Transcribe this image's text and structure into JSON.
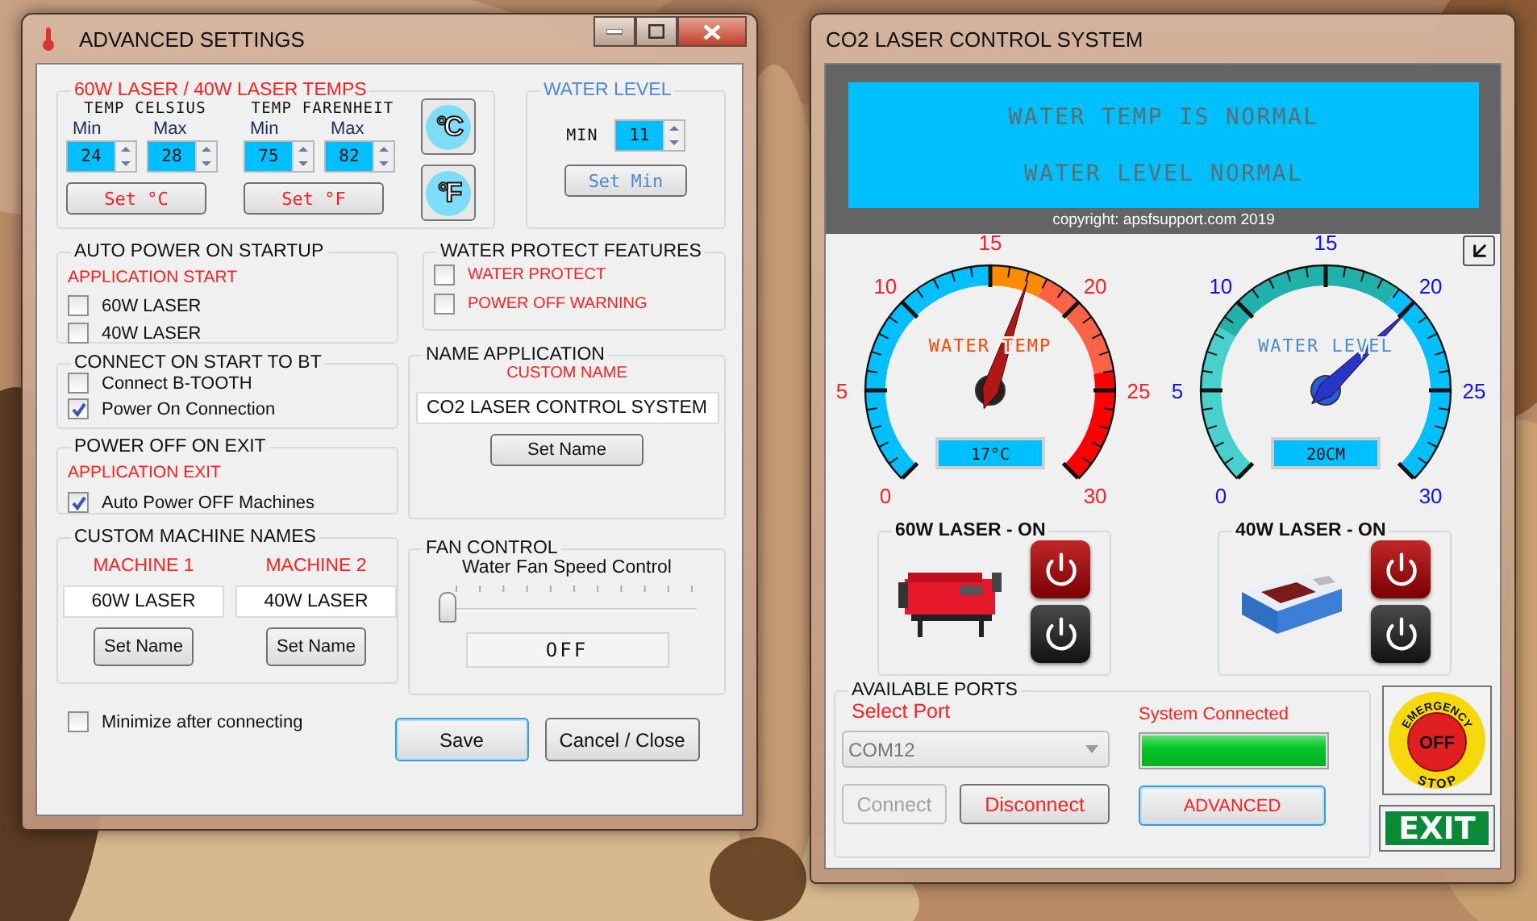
{
  "advanced_window": {
    "title": "ADVANCED SETTINGS",
    "temps": {
      "title": "60W LASER / 40W LASER TEMPS",
      "units": [
        {
          "heading": "TEMP CELSIUS",
          "fields": [
            {
              "label": "Min",
              "value": "24"
            },
            {
              "label": "Max",
              "value": "28"
            }
          ],
          "button": "Set °C"
        },
        {
          "heading": "TEMP FARENHEIT",
          "fields": [
            {
              "label": "Min",
              "value": "75"
            },
            {
              "label": "Max",
              "value": "82"
            }
          ],
          "button": "Set °F"
        }
      ],
      "unit_buttons": [
        "°C",
        "°F"
      ]
    },
    "water_level": {
      "title": "WATER LEVEL",
      "label": "MIN",
      "value": "11",
      "button": "Set Min"
    },
    "auto_power": {
      "title": "AUTO POWER ON STARTUP",
      "subtitle": "APPLICATION  START",
      "options": [
        {
          "label": "60W  LASER",
          "checked": false
        },
        {
          "label": "40W  LASER",
          "checked": false
        }
      ]
    },
    "water_protect": {
      "title": "WATER PROTECT FEATURES",
      "options": [
        {
          "label": "WATER PROTECT",
          "checked": false
        },
        {
          "label": "POWER OFF WARNING",
          "checked": false
        }
      ]
    },
    "connect_bt": {
      "title": "CONNECT ON START TO BT",
      "options": [
        {
          "label": "Connect B-TOOTH",
          "checked": false
        },
        {
          "label": "Power On Connection",
          "checked": true
        }
      ]
    },
    "name_application": {
      "title": "NAME APPLICATION",
      "subtitle": "CUSTOM NAME",
      "value": "CO2 LASER CONTROL SYSTEM",
      "button": "Set Name"
    },
    "power_off": {
      "title": "POWER OFF ON EXIT",
      "subtitle": "APPLICATION EXIT",
      "options": [
        {
          "label": "Auto Power OFF Machines",
          "checked": true
        }
      ]
    },
    "machine_names": {
      "title": "CUSTOM MACHINE NAMES",
      "machines": [
        {
          "label": "MACHINE 1",
          "value": "60W LASER",
          "button": "Set Name"
        },
        {
          "label": "MACHINE 2",
          "value": "40W LASER",
          "button": "Set Name"
        }
      ]
    },
    "fan": {
      "title": "FAN CONTROL",
      "label": "Water Fan Speed Control",
      "level": 0,
      "reading": "OFF"
    },
    "minimize": {
      "label": "Minimize after connecting",
      "checked": false
    },
    "buttons": [
      "Save",
      "Cancel / Close"
    ]
  },
  "control_window": {
    "title": "CO2 LASER CONTROL SYSTEM",
    "status_lines": [
      "WATER TEMP IS NORMAL",
      "WATER LEVEL NORMAL"
    ],
    "copyright": "copyright: apsfsupport.com 2019",
    "gauges": [
      {
        "kind": "temp",
        "label": "WATER TEMP",
        "reading": "17°C",
        "ticks": [
          "0",
          "5",
          "10",
          "15",
          "20",
          "25",
          "30"
        ],
        "level": 0.57
      },
      {
        "kind": "level",
        "label": "WATER LEVEL",
        "reading": "20CM",
        "ticks": [
          "0",
          "5",
          "10",
          "15",
          "20",
          "25",
          "30"
        ],
        "level": 0.67
      }
    ],
    "lasers": [
      {
        "title": "60W LASER - ON",
        "kind": "cutter"
      },
      {
        "title": "40W LASER - ON",
        "kind": "engraver"
      }
    ],
    "ports": {
      "title": "AVAILABLE PORTS",
      "label": "Select Port",
      "value": "COM12",
      "status": "System Connected",
      "level": 1,
      "buttons": [
        {
          "label": "Connect",
          "disabled": true
        },
        {
          "label": "Disconnect",
          "disabled": false
        }
      ],
      "advanced": "ADVANCED"
    },
    "emergency": {
      "top": "EMERGENCY",
      "center": "OFF",
      "bottom": "STOP"
    },
    "exit": "EXIT"
  }
}
